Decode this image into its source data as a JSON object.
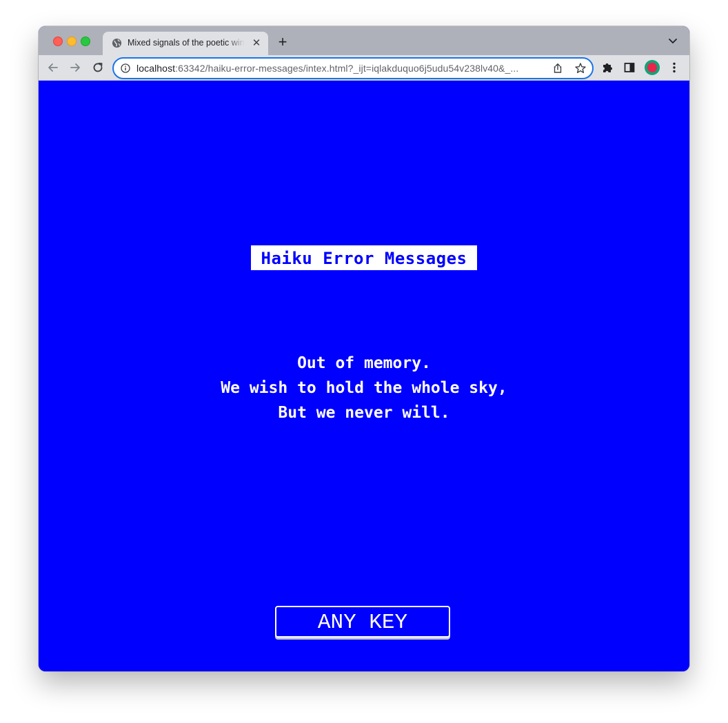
{
  "browser": {
    "tab": {
      "title": "Mixed signals of the poetic wind",
      "favicon": "globe-icon",
      "close_icon": "close-icon"
    },
    "new_tab_icon": "plus-icon",
    "tab_search_icon": "chevron-down-icon",
    "toolbar": {
      "back_icon": "arrow-left-icon",
      "forward_icon": "arrow-right-icon",
      "reload_icon": "reload-icon",
      "url_host": "localhost",
      "url_rest": ":63342/haiku-error-messages/intex.html?_ijt=iqlakduquo6j5udu54v238lv40&_...",
      "site_info_icon": "info-icon",
      "share_icon": "share-icon",
      "bookmark_icon": "star-icon",
      "extensions_icon": "puzzle-icon",
      "side_panel_icon": "side-panel-icon",
      "menu_icon": "kebab-menu-icon"
    },
    "accent_color": "#1a73e8"
  },
  "page": {
    "background_color": "#0000ff",
    "title": "Haiku Error Messages",
    "haiku": [
      "Out of memory.",
      "We wish to hold the whole sky,",
      "But we never will."
    ],
    "button_label": "ANY KEY"
  }
}
